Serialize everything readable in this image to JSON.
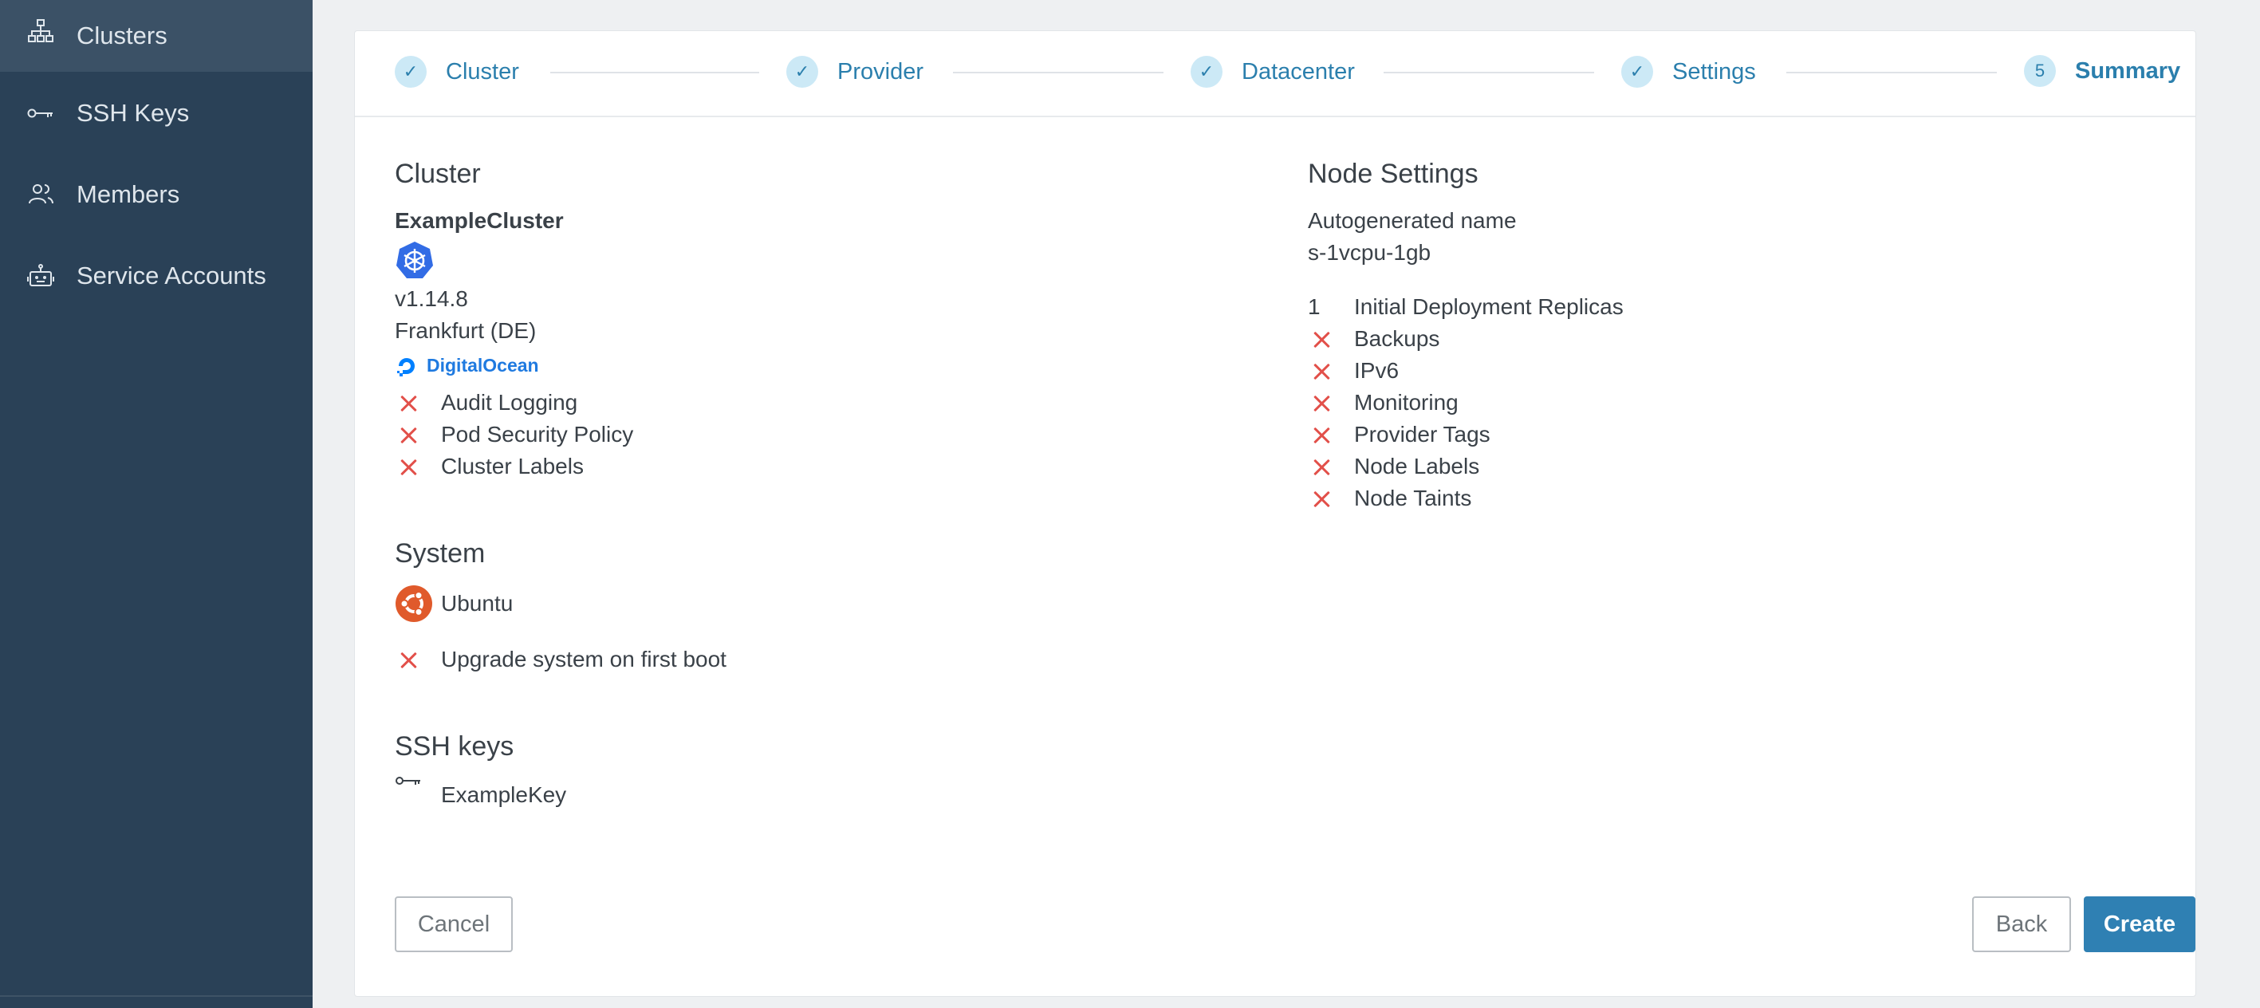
{
  "sidebar": {
    "items": [
      {
        "label": "Clusters",
        "icon": "sitemap-icon"
      },
      {
        "label": "SSH Keys",
        "icon": "key-icon"
      },
      {
        "label": "Members",
        "icon": "users-icon"
      },
      {
        "label": "Service Accounts",
        "icon": "robot-icon"
      }
    ]
  },
  "stepper": {
    "steps": [
      {
        "label": "Cluster",
        "marker": "✓"
      },
      {
        "label": "Provider",
        "marker": "✓"
      },
      {
        "label": "Datacenter",
        "marker": "✓"
      },
      {
        "label": "Settings",
        "marker": "✓"
      },
      {
        "label": "Summary",
        "marker": "5"
      }
    ]
  },
  "cluster": {
    "title": "Cluster",
    "name": "ExampleCluster",
    "version": "v1.14.8",
    "location": "Frankfurt (DE)",
    "provider": "DigitalOcean",
    "options": [
      "Audit Logging",
      "Pod Security Policy",
      "Cluster Labels"
    ]
  },
  "system": {
    "title": "System",
    "os": "Ubuntu",
    "upgrade": "Upgrade system on first boot"
  },
  "ssh": {
    "title": "SSH keys",
    "key": "ExampleKey"
  },
  "node": {
    "title": "Node Settings",
    "name_label": "Autogenerated name",
    "size": "s-1vcpu-1gb",
    "replicas_count": "1",
    "replicas_label": "Initial Deployment Replicas",
    "options": [
      "Backups",
      "IPv6",
      "Monitoring",
      "Provider Tags",
      "Node Labels",
      "Node Taints"
    ]
  },
  "actions": {
    "cancel": "Cancel",
    "back": "Back",
    "create": "Create"
  },
  "colors": {
    "sidebar_bg": "#2a4157",
    "accent": "#2f80b3",
    "disabled_x": "#e2504a",
    "ubuntu": "#e05a2b",
    "kubernetes": "#326ce5",
    "digitalocean": "#0080ff"
  }
}
